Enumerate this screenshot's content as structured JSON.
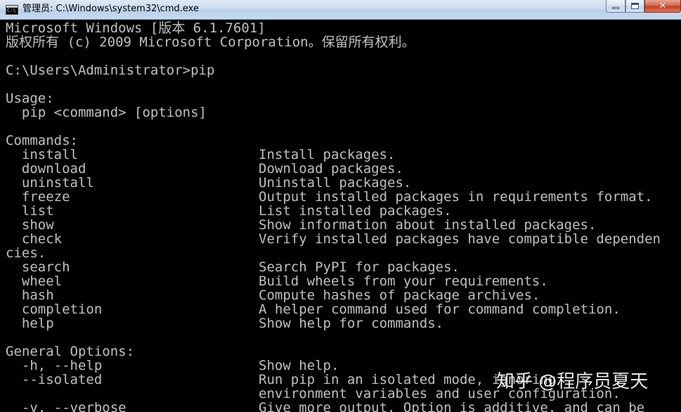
{
  "window": {
    "title": "管理员: C:\\Windows\\system32\\cmd.exe",
    "icon_text": "C:\\",
    "buttons": {
      "minimize": "minimize-icon",
      "maximize": "maximize-icon",
      "close": "close-icon"
    }
  },
  "console": {
    "banner": [
      "Microsoft Windows [版本 6.1.7601]",
      "版权所有 (c) 2009 Microsoft Corporation。保留所有权利。"
    ],
    "prompt": "C:\\Users\\Administrator>pip",
    "usage_header": "Usage:",
    "usage_line": "  pip <command> [options]",
    "commands_header": "Commands:",
    "commands": [
      {
        "name": "  install",
        "desc": "Install packages."
      },
      {
        "name": "  download",
        "desc": "Download packages."
      },
      {
        "name": "  uninstall",
        "desc": "Uninstall packages."
      },
      {
        "name": "  freeze",
        "desc": "Output installed packages in requirements format."
      },
      {
        "name": "  list",
        "desc": "List installed packages."
      },
      {
        "name": "  show",
        "desc": "Show information about installed packages."
      },
      {
        "name": "  check",
        "desc": "Verify installed packages have compatible dependen"
      }
    ],
    "check_wrap": "cies.",
    "commands_more": [
      {
        "name": "  search",
        "desc": "Search PyPI for packages."
      },
      {
        "name": "  wheel",
        "desc": "Build wheels from your requirements."
      },
      {
        "name": "  hash",
        "desc": "Compute hashes of package archives."
      },
      {
        "name": "  completion",
        "desc": "A helper command used for command completion."
      },
      {
        "name": "  help",
        "desc": "Show help for commands."
      }
    ],
    "general_header": "General Options:",
    "options": [
      {
        "name": "  -h, --help",
        "desc": "Show help."
      },
      {
        "name": "  --isolated",
        "desc": "Run pip in an isolated mode, ignoring"
      },
      {
        "name": "",
        "desc": "environment variables and user configuration."
      },
      {
        "name": "  -v, --verbose",
        "desc": "Give more output. Option is additive, and can be"
      }
    ]
  },
  "watermark": "知乎 @程序员夏天"
}
